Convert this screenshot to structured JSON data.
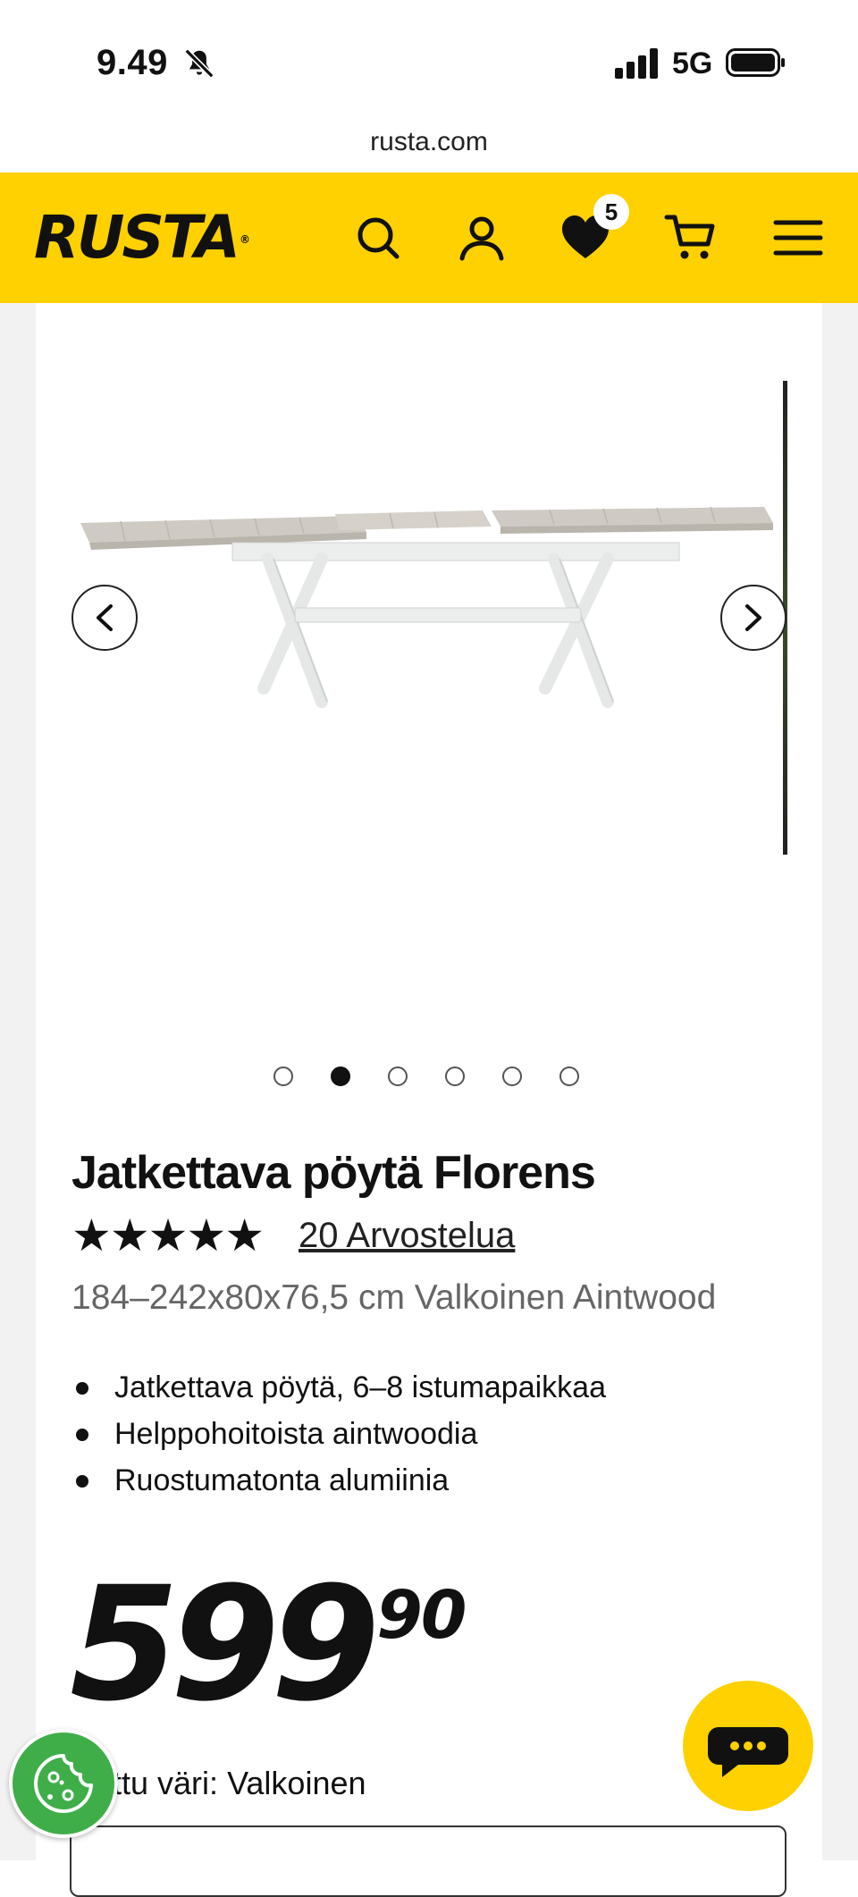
{
  "status_bar": {
    "time": "9.49",
    "network": "5G"
  },
  "browser": {
    "url": "rusta.com"
  },
  "header": {
    "logo": "RUSTA",
    "logo_mark": "®",
    "icons": [
      "search-icon",
      "user-icon",
      "heart-icon",
      "cart-icon",
      "menu-icon"
    ],
    "wishlist_count": "5",
    "brand_color": "#FFD100"
  },
  "gallery": {
    "slide_count": 6,
    "active_index": 1
  },
  "product": {
    "title": "Jatkettava pöytä Florens",
    "rating_stars": "★★★★★",
    "rating_value": 5,
    "reviews_link": "20 Arvostelua",
    "subtitle": "184–242x80x76,5 cm Valkoinen Aintwood",
    "features": [
      "Jatkettava pöytä, 6–8 istumapaikkaa",
      "Helppohoitoista aintwoodia",
      "Ruostumatonta alumiinia"
    ],
    "price_integer": "599",
    "price_decimal": "90",
    "color_label_visible": "ittu väri:",
    "color_value": "Valkoinen"
  }
}
